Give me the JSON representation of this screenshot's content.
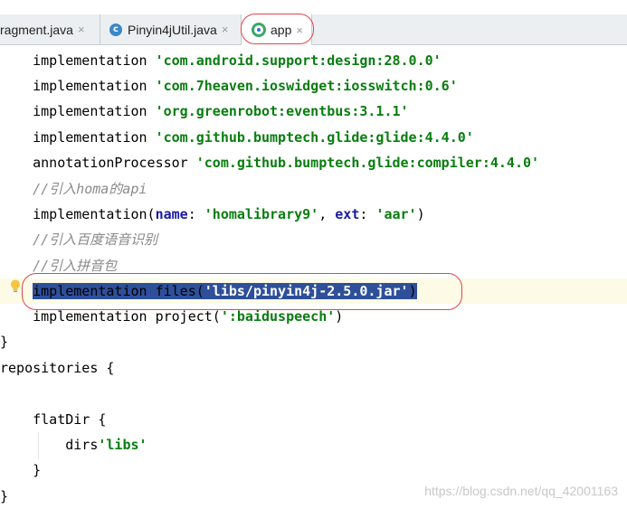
{
  "tabs": [
    {
      "label": "ragment.java",
      "close": "×",
      "icon": "none"
    },
    {
      "label": "Pinyin4jUtil.java",
      "close": "×",
      "icon": "c",
      "icon_name": "class-icon"
    },
    {
      "label": "app",
      "close": "×",
      "icon": "gradle-icon",
      "active": true
    }
  ],
  "editor": {
    "lines": [
      {
        "indent": "    ",
        "prefix": "implementation ",
        "string": "'com.android.support:design:28.0.0'"
      },
      {
        "indent": "    ",
        "prefix": "implementation ",
        "string": "'com.7heaven.ioswidget:iosswitch:0.6'"
      },
      {
        "indent": "    ",
        "prefix": "implementation ",
        "string": "'org.greenrobot:eventbus:3.1.1'"
      },
      {
        "indent": "    ",
        "prefix": "implementation ",
        "string": "'com.github.bumptech.glide:glide:4.4.0'"
      },
      {
        "indent": "    ",
        "prefix": "annotationProcessor ",
        "string": "'com.github.bumptech.glide:compiler:4.4.0'"
      },
      {
        "indent": "    ",
        "comment": "//引入homa的api"
      },
      {
        "indent": "    ",
        "prefix": "implementation(",
        "param1": "name",
        "sep1": ": ",
        "string1": "'homalibrary9'",
        "sep2": ", ",
        "param2": "ext",
        "sep3": ": ",
        "string2": "'aar'",
        "suffix": ")"
      },
      {
        "indent": "    ",
        "comment": "//引入百度语音识别"
      },
      {
        "indent": "    ",
        "comment": "//引入拼音包"
      },
      {
        "indent": "    ",
        "prefix": "implementation files(",
        "string": "'libs/pinyin4j-2.5.0.jar'",
        "suffix": ")",
        "selected": true
      },
      {
        "indent": "    ",
        "prefix": "implementation project(",
        "string": "':baiduspeech'",
        "suffix": ")"
      },
      {
        "indent": "",
        "prefix": "}"
      },
      {
        "indent": "",
        "prefix": "repositories {"
      },
      {
        "indent": "",
        "prefix": ""
      },
      {
        "indent": "    ",
        "prefix": "flatDir {"
      },
      {
        "indent": "        ",
        "prefix": "dirs",
        "string": "'libs'"
      },
      {
        "indent": "    ",
        "prefix": "}"
      },
      {
        "indent": "",
        "prefix": "}"
      }
    ]
  },
  "watermark": "https://blog.csdn.net/qq_42001163",
  "colors": {
    "string": "#087d0f",
    "param": "#1b1ba6",
    "comment": "#8a8a8a",
    "selection": "#2e4f9a",
    "annotation": "#e0464a"
  }
}
